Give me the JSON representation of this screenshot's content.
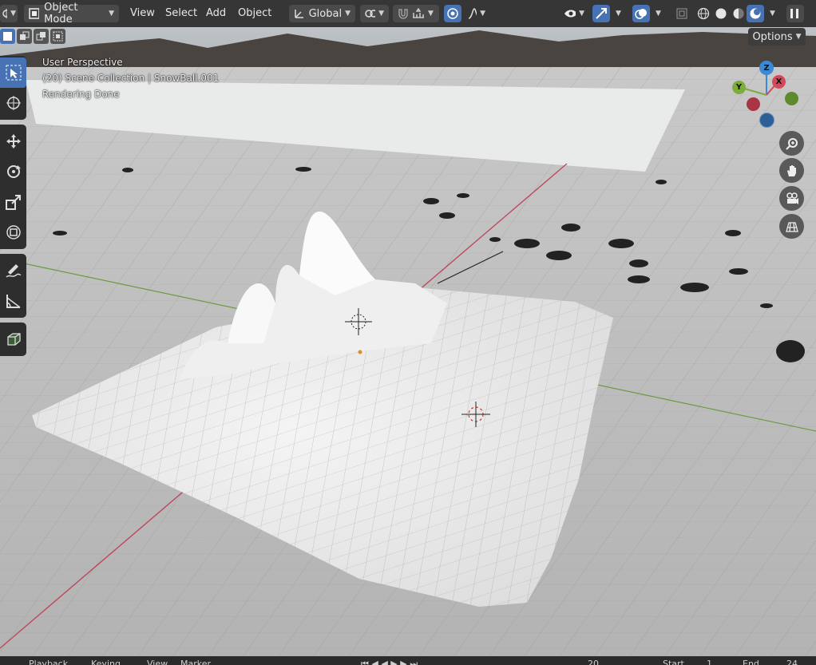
{
  "header": {
    "mode": "Object Mode",
    "menu": [
      "View",
      "Select",
      "Add",
      "Object"
    ],
    "transform_orientation": "Global",
    "options_label": "Options"
  },
  "viewport": {
    "perspective": "User Perspective",
    "collection": "(20) Scene Collection | SnowBall.001",
    "status": "Rendering Done"
  },
  "gizmo": {
    "z": "Z",
    "y": "Y",
    "x": "X"
  },
  "toolbar": {
    "tools": [
      "select-box",
      "cursor",
      "move",
      "rotate",
      "scale",
      "transform",
      "annotate",
      "measure",
      "add-cube"
    ]
  },
  "bottombar": {
    "playback": "Playback",
    "keying": "Keying",
    "view": "View",
    "marker": "Marker",
    "current_frame": "20",
    "start": "Start",
    "start_value": "1",
    "end": "End",
    "end_value": "24"
  },
  "colors": {
    "accent": "#4772b3",
    "header_bg": "#303030",
    "x_axis": "#c04050",
    "y_axis": "#6a9a3a"
  }
}
